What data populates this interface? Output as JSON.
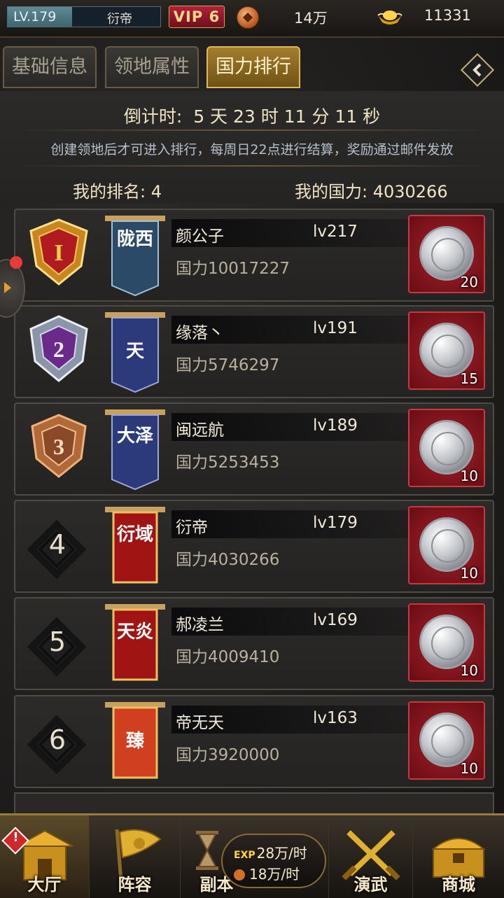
{
  "topbar": {
    "level": "LV.179",
    "player_name": "衍帝",
    "vip": "VIP 6",
    "copper": "14万",
    "gold": "11331"
  },
  "tabs": [
    {
      "label": "基础信息",
      "active": false
    },
    {
      "label": "领地属性",
      "active": false
    },
    {
      "label": "国力排行",
      "active": true
    }
  ],
  "info": {
    "countdown_label": "倒计时:",
    "countdown_value": "5 天 23 时 11 分 11 秒",
    "notice": "创建领地后才可进入排行，每周日22点进行结算，奖励通过邮件发放",
    "my_rank": "我的排名: 4",
    "my_power": "我的国力: 4030266"
  },
  "rankings": [
    {
      "rank": "1",
      "banner": "陇西",
      "name": "颜公子",
      "level": "lv217",
      "power": "国力10017227",
      "reward_count": "20"
    },
    {
      "rank": "2",
      "banner": "天",
      "name": "缘落丶",
      "level": "lv191",
      "power": "国力5746297",
      "reward_count": "15"
    },
    {
      "rank": "3",
      "banner": "大泽",
      "name": "闽远航",
      "level": "lv189",
      "power": "国力5253453",
      "reward_count": "10"
    },
    {
      "rank": "4",
      "banner": "衍域",
      "name": "衍帝",
      "level": "lv179",
      "power": "国力4030266",
      "reward_count": "10"
    },
    {
      "rank": "5",
      "banner": "天炎",
      "name": "郝凌兰",
      "level": "lv169",
      "power": "国力4009410",
      "reward_count": "10"
    },
    {
      "rank": "6",
      "banner": "臻",
      "name": "帝无天",
      "level": "lv163",
      "power": "国力3920000",
      "reward_count": "10"
    }
  ],
  "nav": {
    "hall": "大厅",
    "lineup": "阵容",
    "dungeon": "副本",
    "exp_rate": "28万/时",
    "copper_rate": "18万/时",
    "exp_tag": "EXP",
    "alert": "!",
    "martial": "演武",
    "shop": "商城"
  },
  "colors": {
    "accent_gold": "#d8a24a",
    "reward_red": "#a4222a",
    "vip_red": "#b3203a"
  }
}
